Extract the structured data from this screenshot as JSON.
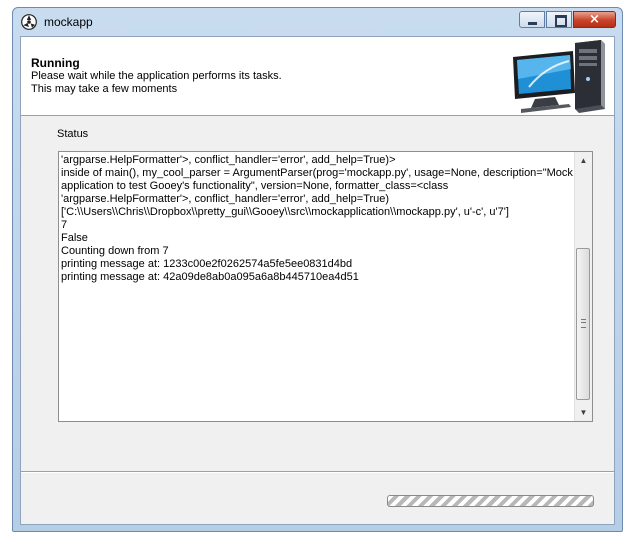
{
  "window": {
    "title": "mockapp",
    "buttons": {
      "minimize": "minimize",
      "maximize": "maximize",
      "close": "×"
    }
  },
  "header": {
    "title": "Running",
    "subtitle_line1": "Please wait while the application performs its tasks.",
    "subtitle_line2": "This may take a few moments"
  },
  "status": {
    "label": "Status",
    "log_lines": [
      "'argparse.HelpFormatter'>, conflict_handler='error', add_help=True)>",
      "inside of main(), my_cool_parser = ArgumentParser(prog='mockapp.py', usage=None, description=\"Mock",
      "application to test Gooey's functionality\", version=None, formatter_class=<class",
      "'argparse.HelpFormatter'>, conflict_handler='error', add_help=True)",
      "['C:\\\\Users\\\\Chris\\\\Dropbox\\\\pretty_gui\\\\Gooey\\\\src\\\\mockapplication\\\\mockapp.py', u'-c', u'7']",
      "7",
      "False",
      "Counting down from 7",
      "printing message at: 1233c00e2f0262574a5fe5ee0831d4bd",
      "printing message at: 42a09de8ab0a095a6a8b445710ea4d51"
    ]
  },
  "progress": {
    "mode": "indeterminate"
  },
  "colors": {
    "title_bar": "#c9dcef",
    "close_button": "#c8442a",
    "client_bg": "#f0f0f0"
  }
}
